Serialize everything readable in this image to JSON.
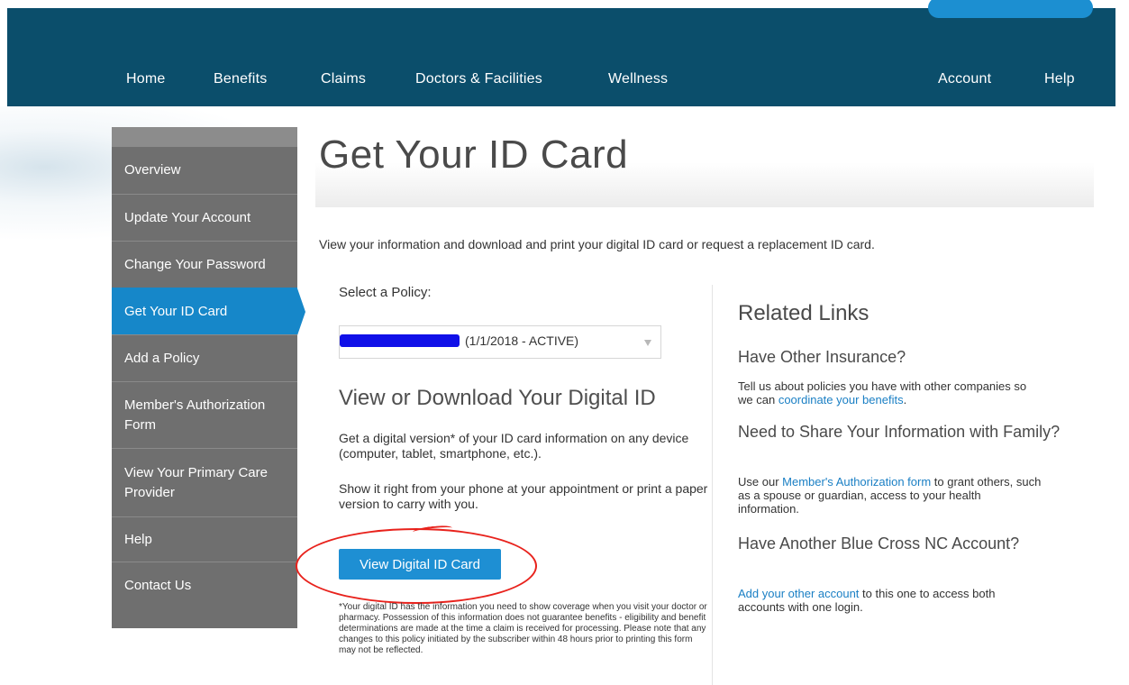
{
  "nav": {
    "home": "Home",
    "benefits": "Benefits",
    "claims": "Claims",
    "doctors": "Doctors & Facilities",
    "wellness": "Wellness",
    "account": "Account",
    "help": "Help"
  },
  "sidebar": {
    "items": [
      {
        "label": "Overview"
      },
      {
        "label": "Update Your Account"
      },
      {
        "label": "Change Your Password"
      },
      {
        "label": "Get Your ID Card"
      },
      {
        "label": "Add a Policy"
      },
      {
        "label": "Member's Authorization Form"
      },
      {
        "label": "View Your Primary Care Provider"
      },
      {
        "label": "Help"
      },
      {
        "label": "Contact Us"
      }
    ]
  },
  "page": {
    "title": "Get Your ID Card",
    "intro": "View your information and download and print your digital ID card or request a replacement ID card."
  },
  "policy": {
    "label": "Select a Policy:",
    "selected": "(1/1/2018 - ACTIVE)"
  },
  "digital": {
    "heading": "View or Download Your Digital ID",
    "p1": "Get a digital version* of your ID card information on any device (computer, tablet, smartphone, etc.).",
    "p2": "Show it right from your phone at your appointment or print a paper version to carry with you.",
    "button": "View Digital ID Card",
    "disclaimer": "*Your digital ID has the information you need to show coverage when you visit your doctor or pharmacy. Possession of this information does not guarantee benefits - eligibility and benefit determinations are made at the time a claim is received for processing. Please note that any changes to this policy initiated by the subscriber within 48 hours prior to printing this form may not be reflected."
  },
  "related": {
    "title": "Related Links",
    "h1": "Have Other Insurance?",
    "p1_pre": "Tell us about policies you have with other companies so we can ",
    "p1_link": "coordinate your benefits",
    "p1_post": ".",
    "h2": "Need to Share Your Information with Family?",
    "p2_pre": "Use our ",
    "p2_link": "Member's Authorization form",
    "p2_post": " to grant others, such as a spouse or guardian, access to your health information.",
    "h3": "Have Another Blue Cross NC Account?",
    "p3_link": "Add your other account",
    "p3_post": " to this one to access both accounts with one login."
  },
  "colors": {
    "navbar": "#0b4e6b",
    "accent": "#1e8fd3",
    "sidebar": "#6f6f6f",
    "annotation": "#e8221c"
  }
}
